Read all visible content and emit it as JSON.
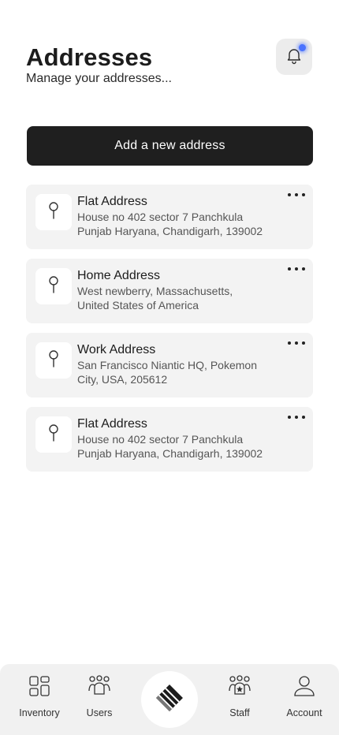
{
  "header": {
    "title": "Addresses",
    "subtitle": "Manage your addresses..."
  },
  "add_button_label": "Add a new address",
  "addresses": [
    {
      "title": "Flat Address",
      "line1": "House no 402 sector 7 Panchkula",
      "line2": "Punjab Haryana, Chandigarh, 139002"
    },
    {
      "title": "Home Address",
      "line1": "West newberry, Massachusetts,",
      "line2": "United States of America"
    },
    {
      "title": "Work Address",
      "line1": "San Francisco Niantic HQ, Pokemon",
      "line2": "City, USA, 205612"
    },
    {
      "title": "Flat Address",
      "line1": "House no 402 sector 7 Panchkula",
      "line2": "Punjab Haryana, Chandigarh, 139002"
    }
  ],
  "tabbar": {
    "inventory": "Inventory",
    "users": "Users",
    "staff": "Staff",
    "account": "Account"
  },
  "icons": {
    "notification": "bell-icon",
    "address": "map-pin-icon",
    "more": "more-dots-icon",
    "center": "logo-icon"
  },
  "colors": {
    "primary_button": "#1f1f1f",
    "notification_dot": "#4a73ff",
    "card_background": "#f3f3f3"
  }
}
